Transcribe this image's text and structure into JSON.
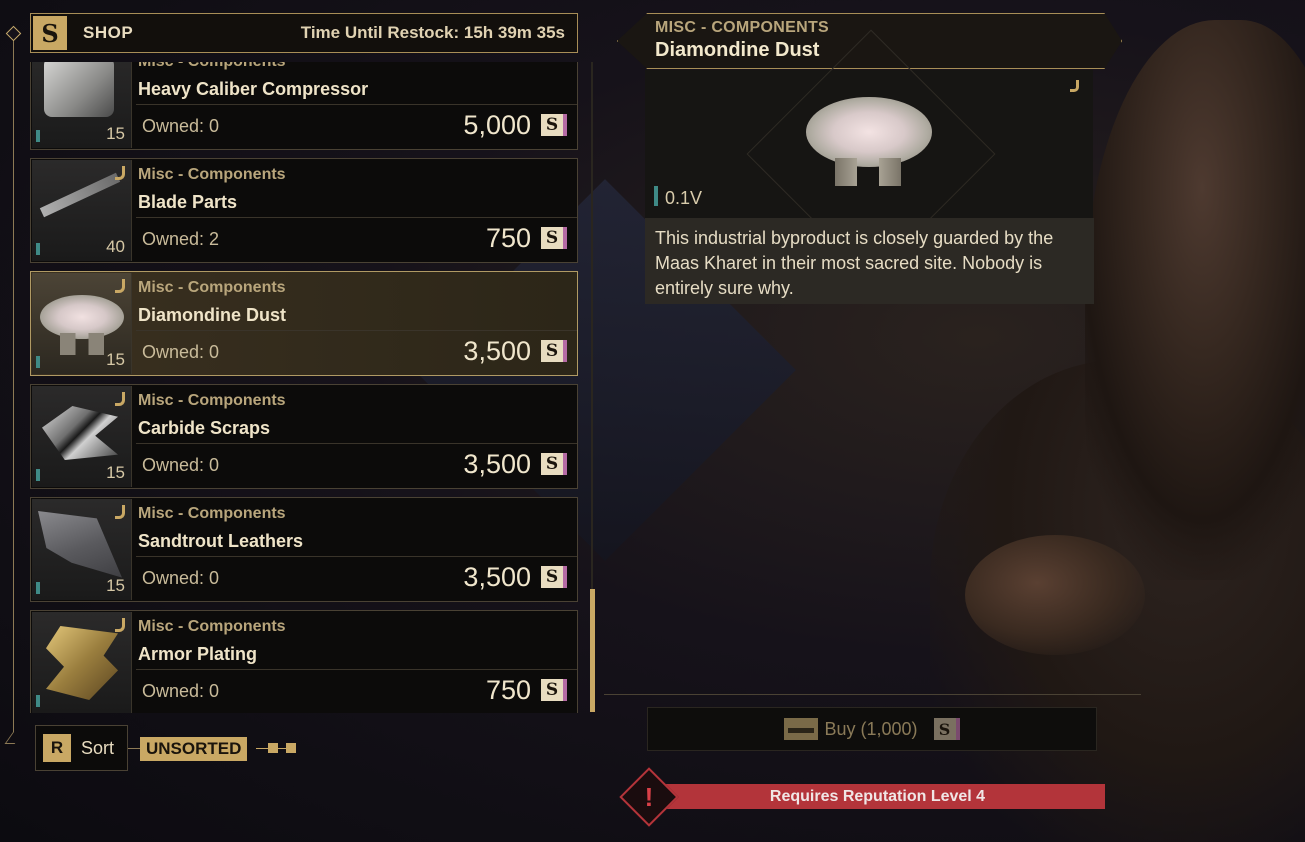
{
  "shop": {
    "logo_glyph": "S",
    "title": "SHOP",
    "restock": "Time Until Restock: 15h 39m 35s"
  },
  "items": [
    {
      "category": "Misc - Components",
      "name": "Heavy Caliber Compressor",
      "owned": "Owned: 0",
      "price": "5,000",
      "qty": "15",
      "coin": "S"
    },
    {
      "category": "Misc - Components",
      "name": "Blade Parts",
      "owned": "Owned: 2",
      "price": "750",
      "qty": "40",
      "coin": "S"
    },
    {
      "category": "Misc - Components",
      "name": "Diamondine Dust",
      "owned": "Owned: 0",
      "price": "3,500",
      "qty": "15",
      "coin": "S"
    },
    {
      "category": "Misc - Components",
      "name": "Carbide Scraps",
      "owned": "Owned: 0",
      "price": "3,500",
      "qty": "15",
      "coin": "S"
    },
    {
      "category": "Misc - Components",
      "name": "Sandtrout Leathers",
      "owned": "Owned: 0",
      "price": "3,500",
      "qty": "15",
      "coin": "S"
    },
    {
      "category": "Misc - Components",
      "name": "Armor Plating",
      "owned": "Owned: 0",
      "price": "750",
      "qty": "",
      "coin": "S"
    }
  ],
  "sort": {
    "key": "R",
    "label": "Sort",
    "state": "UNSORTED"
  },
  "detail": {
    "category": "MISC - COMPONENTS",
    "name": "Diamondine Dust",
    "volume": "0.1V",
    "description": "This industrial byproduct is closely guarded by the Maas Kharet in their most sacred site. Nobody is entirely sure why."
  },
  "buy": {
    "label": "Buy (1,000)",
    "coin": "S"
  },
  "requirement": {
    "icon": "!",
    "text": "Requires Reputation Level 4"
  },
  "colors": {
    "accent_gold": "#c9a864",
    "warning_red": "#b3343a",
    "volume_teal": "#3f8a86"
  }
}
